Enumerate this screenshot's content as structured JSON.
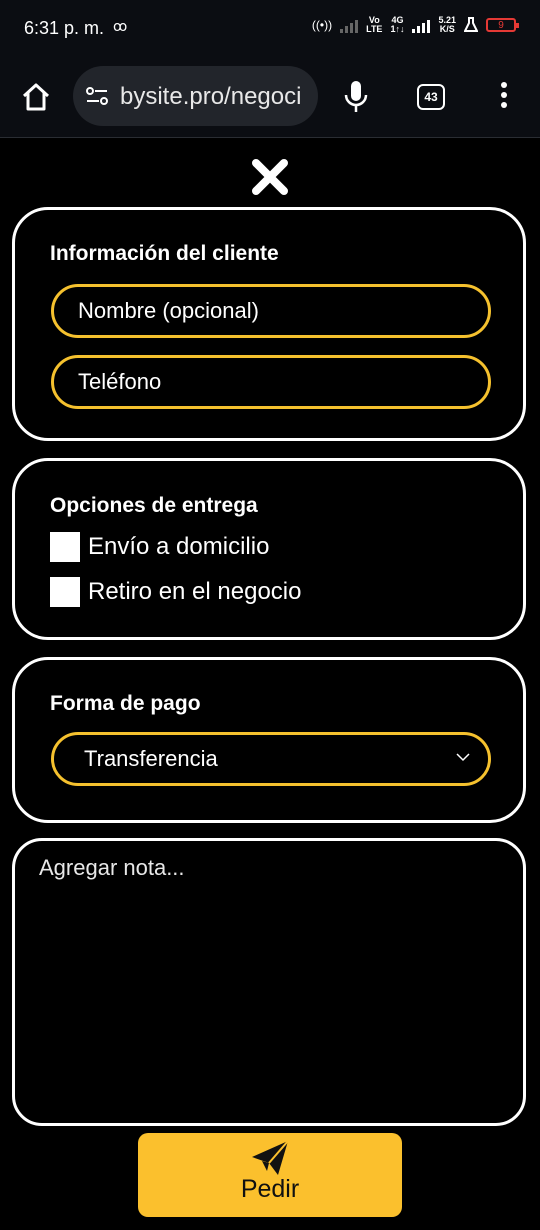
{
  "status_bar": {
    "time": "6:31 p. m.",
    "voicemail_icon": "voicemail-icon",
    "network_labels": [
      "Vo",
      "LTE",
      "4G",
      "1↑↓"
    ],
    "speed": "5.21",
    "speed_unit": "K/S",
    "battery": "9"
  },
  "browser": {
    "url": "bysite.pro/negoci",
    "tab_count": "43"
  },
  "customer_info": {
    "heading": "Información del cliente",
    "name_placeholder": "Nombre (opcional)",
    "phone_placeholder": "Teléfono"
  },
  "delivery": {
    "heading": "Opciones de entrega",
    "options": [
      "Envío a domicilio",
      "Retiro en el negocio"
    ]
  },
  "payment": {
    "heading": "Forma de pago",
    "selected": "Transferencia"
  },
  "note": {
    "placeholder": "Agregar nota..."
  },
  "order_button": {
    "label": "Pedir"
  },
  "colors": {
    "accent": "#f5c12e",
    "button": "#fbc02d",
    "background": "#000000",
    "battery_low": "#e53935"
  }
}
